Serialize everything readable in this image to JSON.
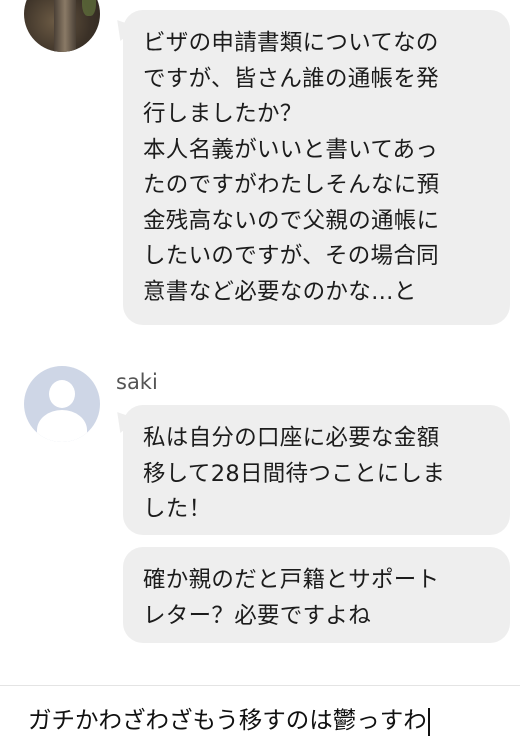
{
  "messages": [
    {
      "avatar": "photo-avatar",
      "text": "ビザの申請書類についてなの\nですが、皆さん誰の通帳を発\n行しましたか？\n本人名義がいいと書いてあっ\nたのですがわたしそんなに預\n金残高ないので父親の通帳に\nしたいのですが、その場合同\n意書など必要なのかな…と"
    },
    {
      "sender": "saki",
      "avatar": "default-avatar",
      "text": "私は自分の口座に必要な金額\n移して28日間待つことにしま\nした！"
    },
    {
      "sender": "saki",
      "text": "確か親のだと戸籍とサポート\nレター？必要ですよね"
    }
  ],
  "input": {
    "value": "ガチかわざわざもう移すのは鬱っすわ"
  }
}
